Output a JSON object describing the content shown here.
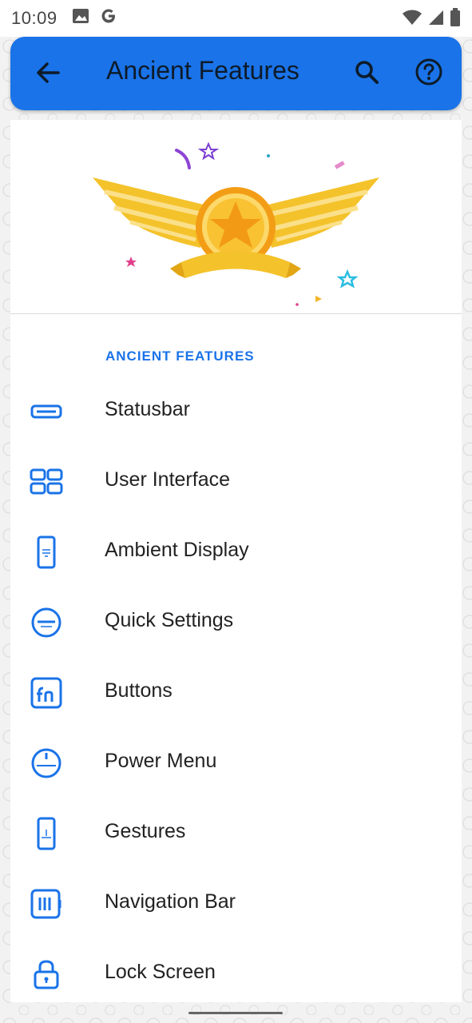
{
  "status_bar": {
    "time": "10:09",
    "left_icons": [
      "image-icon",
      "google-g-icon"
    ],
    "right_icons": [
      "wifi-icon",
      "signal-icon",
      "battery-icon"
    ]
  },
  "app_bar": {
    "title": "Ancient Features",
    "back_icon": "arrow-back-icon",
    "search_icon": "search-icon",
    "help_icon": "help-icon",
    "color": "#1a73e8"
  },
  "hero": {
    "image": "winged-star-badge-illustration"
  },
  "section": {
    "header": "ANCIENT FEATURES"
  },
  "items": [
    {
      "label": "Statusbar",
      "icon": "statusbar-icon"
    },
    {
      "label": "User Interface",
      "icon": "user-interface-icon"
    },
    {
      "label": "Ambient Display",
      "icon": "ambient-display-icon"
    },
    {
      "label": "Quick Settings",
      "icon": "quick-settings-icon"
    },
    {
      "label": "Buttons",
      "icon": "buttons-fn-icon"
    },
    {
      "label": "Power Menu",
      "icon": "power-menu-icon"
    },
    {
      "label": "Gestures",
      "icon": "gestures-icon"
    },
    {
      "label": "Navigation Bar",
      "icon": "navigation-bar-icon"
    },
    {
      "label": "Lock Screen",
      "icon": "lock-icon"
    }
  ]
}
